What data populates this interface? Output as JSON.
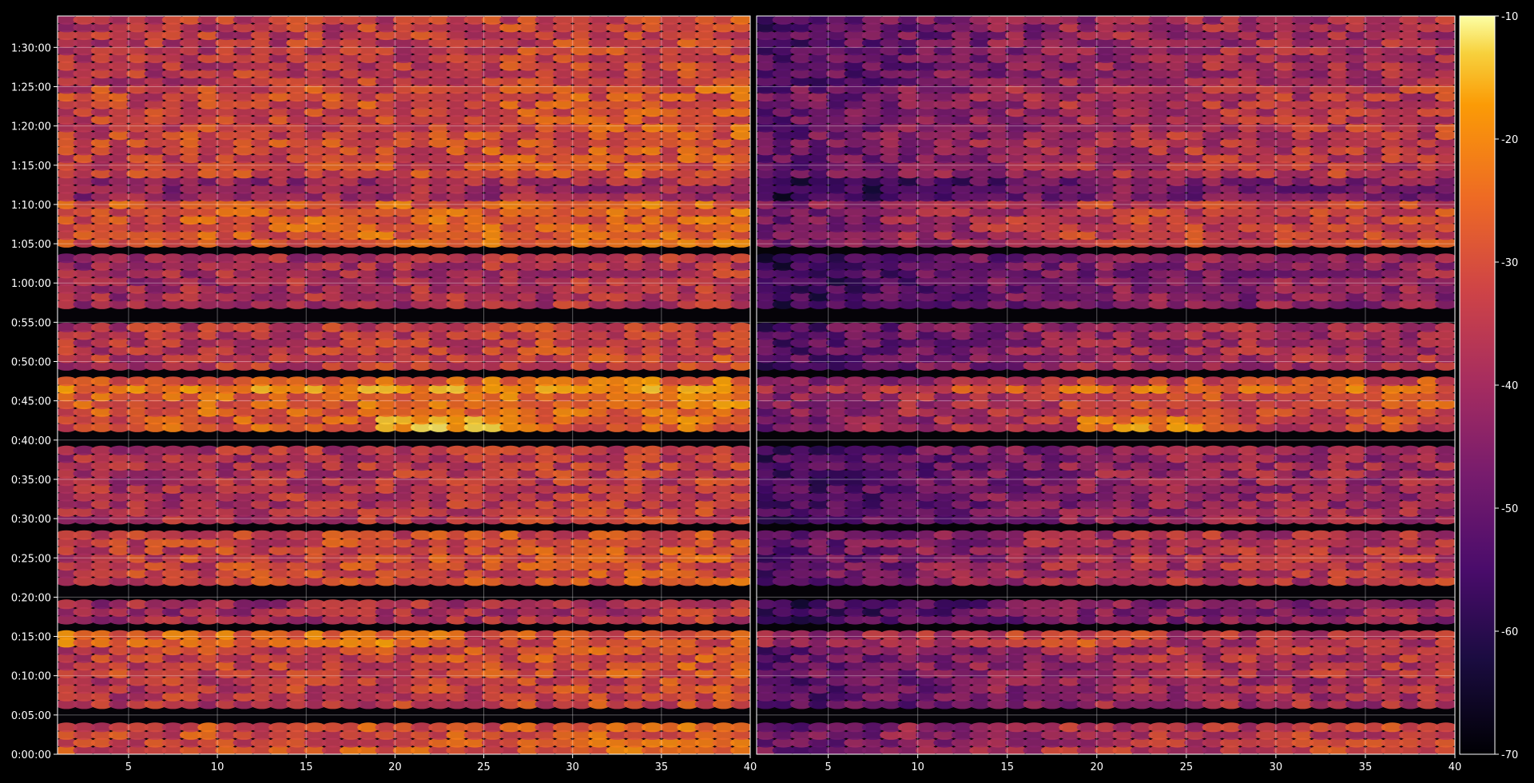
{
  "chart_data": {
    "type": "heatmap",
    "panels": [
      {
        "x_ticks": [
          "5",
          "10",
          "15",
          "20",
          "25",
          "30",
          "35",
          "40"
        ],
        "x_tick_values": [
          5,
          10,
          15,
          20,
          25,
          30,
          35,
          40
        ]
      },
      {
        "x_ticks": [
          "5",
          "10",
          "15",
          "20",
          "25",
          "30",
          "35",
          "40"
        ],
        "x_tick_values": [
          5,
          10,
          15,
          20,
          25,
          30,
          35,
          40
        ]
      }
    ],
    "y_ticks": [
      "0:00:00",
      "0:05:00",
      "0:10:00",
      "0:15:00",
      "0:20:00",
      "0:25:00",
      "0:30:00",
      "0:35:00",
      "0:40:00",
      "0:45:00",
      "0:50:00",
      "0:55:00",
      "1:00:00",
      "1:05:00",
      "1:10:00",
      "1:15:00",
      "1:20:00",
      "1:25:00",
      "1:30:00"
    ],
    "y_tick_values_minutes": [
      0,
      5,
      10,
      15,
      20,
      25,
      30,
      35,
      40,
      45,
      50,
      55,
      60,
      65,
      70,
      75,
      80,
      85,
      90
    ],
    "xlim": [
      1,
      40
    ],
    "ylim_minutes": [
      0,
      94
    ],
    "colorbar": {
      "colormap": "inferno",
      "range": [
        -70,
        -10
      ],
      "ticks": [
        "-10",
        "-20",
        "-30",
        "-40",
        "-50",
        "-60",
        "-70"
      ],
      "tick_values": [
        -10,
        -20,
        -30,
        -40,
        -50,
        -60,
        -70
      ]
    },
    "grid": true,
    "background": "#000000",
    "grid_color": "#ffffff"
  }
}
